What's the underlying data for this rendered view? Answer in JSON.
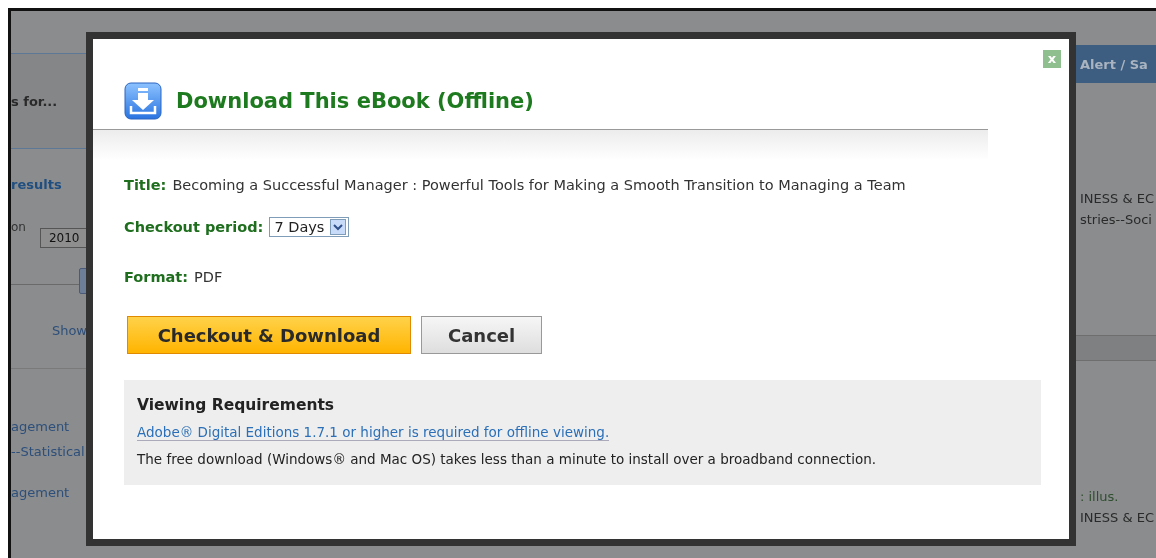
{
  "background": {
    "left": {
      "heading": "s for...",
      "results_link": "results",
      "year_label": "on",
      "year_value": "2010",
      "show_link": "Show",
      "subjects": [
        "agement",
        "--Statistical",
        "agement"
      ]
    },
    "right": {
      "alert_button": "Alert / Sa",
      "texts": [
        "INESS & EC",
        "stries--Soci"
      ],
      "lower_texts": [
        ": illus.",
        "INESS & EC"
      ]
    }
  },
  "dialog": {
    "title": "Download This eBook (Offline)",
    "close": "x",
    "fields": [
      {
        "kind": "text",
        "label": "Title:",
        "value": "Becoming a Successful Manager : Powerful Tools for Making a Smooth Transition to Managing a Team"
      },
      {
        "kind": "select",
        "label": "Checkout period:",
        "value": "7 Days"
      },
      {
        "kind": "text",
        "label": "Format:",
        "value": "PDF"
      }
    ],
    "buttons": [
      {
        "label": "Checkout & Download",
        "primary": true
      },
      {
        "label": "Cancel",
        "primary": false
      }
    ],
    "requirements": {
      "heading": "Viewing Requirements",
      "link": "Adobe® Digital Editions 1.7.1 or higher is required for offline viewing.",
      "note": "The free download (Windows® and Mac OS) takes less than a minute to install over a broadband connection."
    }
  }
}
